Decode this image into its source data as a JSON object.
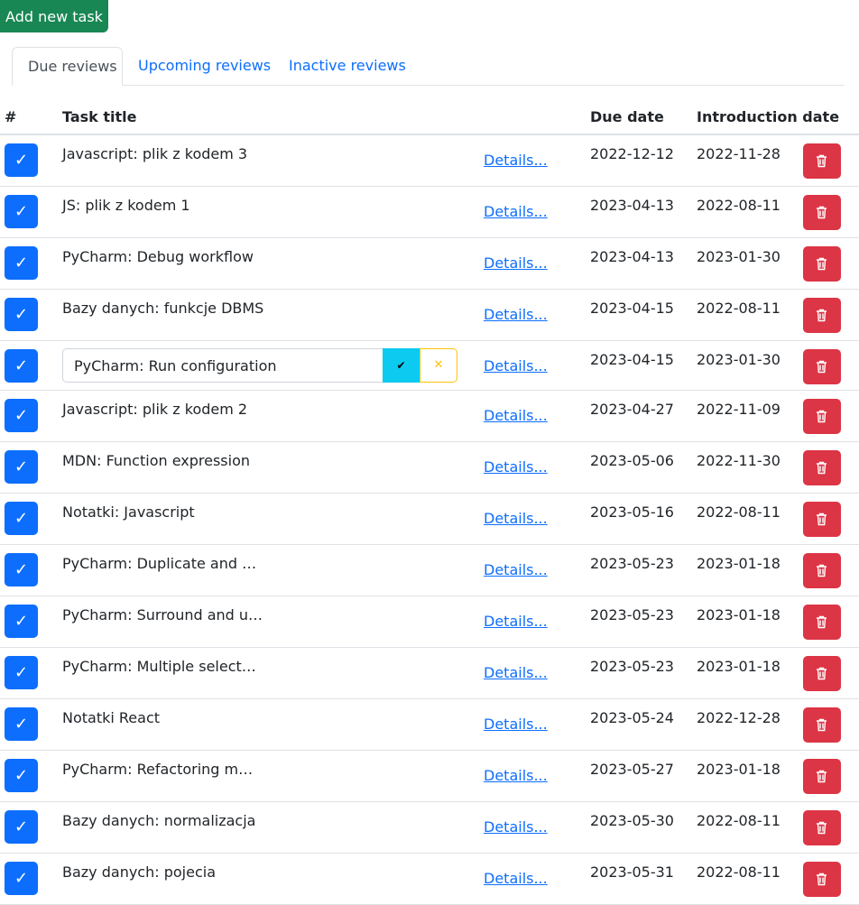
{
  "add_button": "Add new task",
  "tabs": [
    {
      "label": "Due reviews",
      "active": true
    },
    {
      "label": "Upcoming reviews",
      "active": false
    },
    {
      "label": "Inactive reviews",
      "active": false
    }
  ],
  "table": {
    "headers": {
      "num": "#",
      "title": "Task title",
      "due": "Due date",
      "intro": "Introduction date"
    },
    "details_label": "Details...",
    "check_glyph": "✓",
    "edit_ok_glyph": "✔",
    "edit_cancel_glyph": "✕",
    "rows": [
      {
        "title": "Javascript: plik z kodem 3",
        "due": "2022-12-12",
        "intro": "2022-11-28"
      },
      {
        "title": "JS: plik z kodem 1",
        "due": "2023-04-13",
        "intro": "2022-08-11"
      },
      {
        "title": "PyCharm: Debug workflow",
        "due": "2023-04-13",
        "intro": "2023-01-30"
      },
      {
        "title": "Bazy danych: funkcje DBMS",
        "due": "2023-04-15",
        "intro": "2022-08-11"
      },
      {
        "title": "PyCharm: Run configuration",
        "due": "2023-04-15",
        "intro": "2023-01-30",
        "editing": true
      },
      {
        "title": "Javascript: plik z kodem 2",
        "due": "2023-04-27",
        "intro": "2022-11-09"
      },
      {
        "title": "MDN: Function expression",
        "due": "2023-05-06",
        "intro": "2022-11-30"
      },
      {
        "title": "Notatki: Javascript",
        "due": "2023-05-16",
        "intro": "2022-08-11"
      },
      {
        "title": "PyCharm: Duplicate and …",
        "due": "2023-05-23",
        "intro": "2023-01-18"
      },
      {
        "title": "PyCharm: Surround and u…",
        "due": "2023-05-23",
        "intro": "2023-01-18"
      },
      {
        "title": "PyCharm: Multiple select…",
        "due": "2023-05-23",
        "intro": "2023-01-18"
      },
      {
        "title": "Notatki React",
        "due": "2023-05-24",
        "intro": "2022-12-28"
      },
      {
        "title": "PyCharm: Refactoring m…",
        "due": "2023-05-27",
        "intro": "2023-01-18"
      },
      {
        "title": "Bazy danych: normalizacja",
        "due": "2023-05-30",
        "intro": "2022-08-11"
      },
      {
        "title": "Bazy danych: pojecia",
        "due": "2023-05-31",
        "intro": "2022-08-11"
      }
    ]
  },
  "icons": {
    "check": "check-icon",
    "delete": "trash-icon",
    "confirm": "checkmark-icon",
    "cancel": "close-icon"
  },
  "colors": {
    "primary": "#0d6efd",
    "success": "#198754",
    "danger": "#dc3545",
    "info": "#0dcaf0",
    "warning": "#ffc107"
  }
}
